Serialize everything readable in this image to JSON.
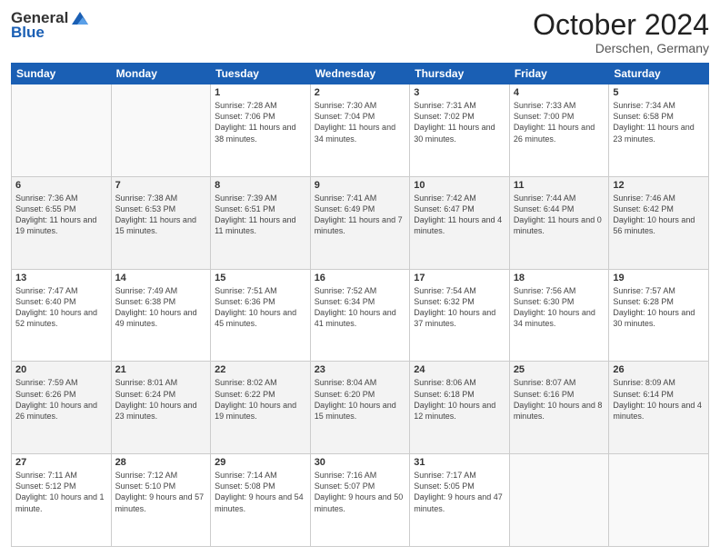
{
  "header": {
    "logo_line1": "General",
    "logo_line2": "Blue",
    "month": "October 2024",
    "location": "Derschen, Germany"
  },
  "weekdays": [
    "Sunday",
    "Monday",
    "Tuesday",
    "Wednesday",
    "Thursday",
    "Friday",
    "Saturday"
  ],
  "weeks": [
    [
      {
        "day": "",
        "sunrise": "",
        "sunset": "",
        "daylight": ""
      },
      {
        "day": "",
        "sunrise": "",
        "sunset": "",
        "daylight": ""
      },
      {
        "day": "1",
        "sunrise": "Sunrise: 7:28 AM",
        "sunset": "Sunset: 7:06 PM",
        "daylight": "Daylight: 11 hours and 38 minutes."
      },
      {
        "day": "2",
        "sunrise": "Sunrise: 7:30 AM",
        "sunset": "Sunset: 7:04 PM",
        "daylight": "Daylight: 11 hours and 34 minutes."
      },
      {
        "day": "3",
        "sunrise": "Sunrise: 7:31 AM",
        "sunset": "Sunset: 7:02 PM",
        "daylight": "Daylight: 11 hours and 30 minutes."
      },
      {
        "day": "4",
        "sunrise": "Sunrise: 7:33 AM",
        "sunset": "Sunset: 7:00 PM",
        "daylight": "Daylight: 11 hours and 26 minutes."
      },
      {
        "day": "5",
        "sunrise": "Sunrise: 7:34 AM",
        "sunset": "Sunset: 6:58 PM",
        "daylight": "Daylight: 11 hours and 23 minutes."
      }
    ],
    [
      {
        "day": "6",
        "sunrise": "Sunrise: 7:36 AM",
        "sunset": "Sunset: 6:55 PM",
        "daylight": "Daylight: 11 hours and 19 minutes."
      },
      {
        "day": "7",
        "sunrise": "Sunrise: 7:38 AM",
        "sunset": "Sunset: 6:53 PM",
        "daylight": "Daylight: 11 hours and 15 minutes."
      },
      {
        "day": "8",
        "sunrise": "Sunrise: 7:39 AM",
        "sunset": "Sunset: 6:51 PM",
        "daylight": "Daylight: 11 hours and 11 minutes."
      },
      {
        "day": "9",
        "sunrise": "Sunrise: 7:41 AM",
        "sunset": "Sunset: 6:49 PM",
        "daylight": "Daylight: 11 hours and 7 minutes."
      },
      {
        "day": "10",
        "sunrise": "Sunrise: 7:42 AM",
        "sunset": "Sunset: 6:47 PM",
        "daylight": "Daylight: 11 hours and 4 minutes."
      },
      {
        "day": "11",
        "sunrise": "Sunrise: 7:44 AM",
        "sunset": "Sunset: 6:44 PM",
        "daylight": "Daylight: 11 hours and 0 minutes."
      },
      {
        "day": "12",
        "sunrise": "Sunrise: 7:46 AM",
        "sunset": "Sunset: 6:42 PM",
        "daylight": "Daylight: 10 hours and 56 minutes."
      }
    ],
    [
      {
        "day": "13",
        "sunrise": "Sunrise: 7:47 AM",
        "sunset": "Sunset: 6:40 PM",
        "daylight": "Daylight: 10 hours and 52 minutes."
      },
      {
        "day": "14",
        "sunrise": "Sunrise: 7:49 AM",
        "sunset": "Sunset: 6:38 PM",
        "daylight": "Daylight: 10 hours and 49 minutes."
      },
      {
        "day": "15",
        "sunrise": "Sunrise: 7:51 AM",
        "sunset": "Sunset: 6:36 PM",
        "daylight": "Daylight: 10 hours and 45 minutes."
      },
      {
        "day": "16",
        "sunrise": "Sunrise: 7:52 AM",
        "sunset": "Sunset: 6:34 PM",
        "daylight": "Daylight: 10 hours and 41 minutes."
      },
      {
        "day": "17",
        "sunrise": "Sunrise: 7:54 AM",
        "sunset": "Sunset: 6:32 PM",
        "daylight": "Daylight: 10 hours and 37 minutes."
      },
      {
        "day": "18",
        "sunrise": "Sunrise: 7:56 AM",
        "sunset": "Sunset: 6:30 PM",
        "daylight": "Daylight: 10 hours and 34 minutes."
      },
      {
        "day": "19",
        "sunrise": "Sunrise: 7:57 AM",
        "sunset": "Sunset: 6:28 PM",
        "daylight": "Daylight: 10 hours and 30 minutes."
      }
    ],
    [
      {
        "day": "20",
        "sunrise": "Sunrise: 7:59 AM",
        "sunset": "Sunset: 6:26 PM",
        "daylight": "Daylight: 10 hours and 26 minutes."
      },
      {
        "day": "21",
        "sunrise": "Sunrise: 8:01 AM",
        "sunset": "Sunset: 6:24 PM",
        "daylight": "Daylight: 10 hours and 23 minutes."
      },
      {
        "day": "22",
        "sunrise": "Sunrise: 8:02 AM",
        "sunset": "Sunset: 6:22 PM",
        "daylight": "Daylight: 10 hours and 19 minutes."
      },
      {
        "day": "23",
        "sunrise": "Sunrise: 8:04 AM",
        "sunset": "Sunset: 6:20 PM",
        "daylight": "Daylight: 10 hours and 15 minutes."
      },
      {
        "day": "24",
        "sunrise": "Sunrise: 8:06 AM",
        "sunset": "Sunset: 6:18 PM",
        "daylight": "Daylight: 10 hours and 12 minutes."
      },
      {
        "day": "25",
        "sunrise": "Sunrise: 8:07 AM",
        "sunset": "Sunset: 6:16 PM",
        "daylight": "Daylight: 10 hours and 8 minutes."
      },
      {
        "day": "26",
        "sunrise": "Sunrise: 8:09 AM",
        "sunset": "Sunset: 6:14 PM",
        "daylight": "Daylight: 10 hours and 4 minutes."
      }
    ],
    [
      {
        "day": "27",
        "sunrise": "Sunrise: 7:11 AM",
        "sunset": "Sunset: 5:12 PM",
        "daylight": "Daylight: 10 hours and 1 minute."
      },
      {
        "day": "28",
        "sunrise": "Sunrise: 7:12 AM",
        "sunset": "Sunset: 5:10 PM",
        "daylight": "Daylight: 9 hours and 57 minutes."
      },
      {
        "day": "29",
        "sunrise": "Sunrise: 7:14 AM",
        "sunset": "Sunset: 5:08 PM",
        "daylight": "Daylight: 9 hours and 54 minutes."
      },
      {
        "day": "30",
        "sunrise": "Sunrise: 7:16 AM",
        "sunset": "Sunset: 5:07 PM",
        "daylight": "Daylight: 9 hours and 50 minutes."
      },
      {
        "day": "31",
        "sunrise": "Sunrise: 7:17 AM",
        "sunset": "Sunset: 5:05 PM",
        "daylight": "Daylight: 9 hours and 47 minutes."
      },
      {
        "day": "",
        "sunrise": "",
        "sunset": "",
        "daylight": ""
      },
      {
        "day": "",
        "sunrise": "",
        "sunset": "",
        "daylight": ""
      }
    ]
  ]
}
